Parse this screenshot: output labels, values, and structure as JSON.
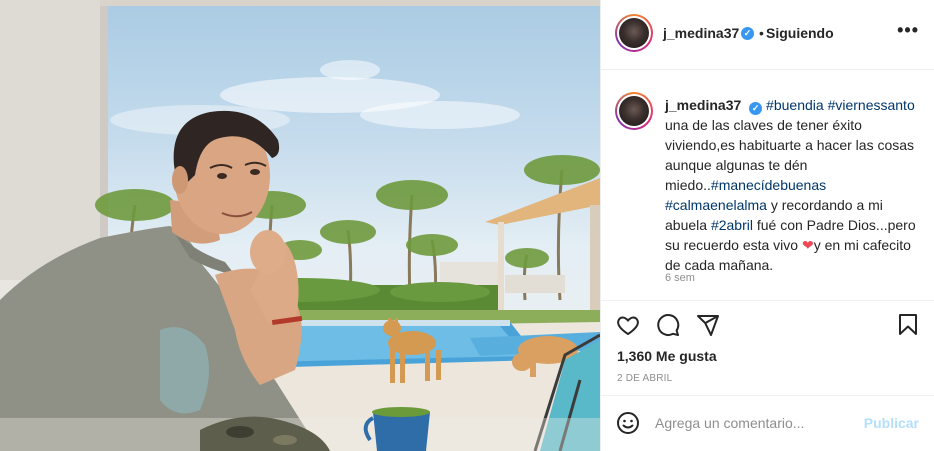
{
  "post": {
    "username": "j_medina37",
    "follow_status": "Siguiendo",
    "caption": {
      "hashtag_1": "#buendia",
      "hashtag_2": "#viernessanto",
      "text_1": " una de las claves de tener éxito viviendo,es habituarte a hacer las cosas aunque algunas te dén miedo..",
      "hashtag_3": "#manecídebuenas",
      "hashtag_4": "#calmaenelalma",
      "text_2": " y recordando a mi abuela ",
      "hashtag_5": "#2abril",
      "text_3": " fué con Padre Dios...pero su recuerdo esta vivo ",
      "heart": "❤",
      "text_4": "y en mi cafecito de cada mañana."
    },
    "time_ago": "6 sem",
    "likes": "1,360 Me gusta",
    "date": "2 DE ABRIL"
  },
  "comment_box": {
    "placeholder": "Agrega un comentario...",
    "publish_label": "Publicar"
  },
  "icons": {
    "verified": "verified-badge-icon",
    "more": "more-options-icon",
    "like": "heart-icon",
    "comment": "comment-bubble-icon",
    "share": "paper-plane-icon",
    "save": "bookmark-icon",
    "emoji": "smiley-icon"
  },
  "colors": {
    "hashtag": "#00376b",
    "verified": "#3897f0",
    "publish_disabled": "#b2dffc",
    "heart": "#ed4956"
  }
}
